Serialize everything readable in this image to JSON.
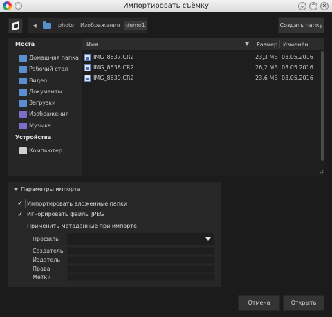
{
  "window": {
    "title": "Импортировать съёмку",
    "controls": {
      "minimize": "⌄",
      "maximize": "⌃",
      "close": "✕"
    }
  },
  "toolbar": {
    "back_icon": "back-icon",
    "breadcrumb": [
      "photo",
      "Изображения",
      "demo1"
    ],
    "create_folder_label": "Создать папку"
  },
  "places": {
    "heading": "Места",
    "items": [
      {
        "label": "Домашняя папка",
        "icon": "home-folder-icon",
        "color": "#5a8fd0"
      },
      {
        "label": "Рабочий стол",
        "icon": "desktop-folder-icon",
        "color": "#5a8fd0"
      },
      {
        "label": "Видео",
        "icon": "video-folder-icon",
        "color": "#5a8fd0"
      },
      {
        "label": "Документы",
        "icon": "documents-folder-icon",
        "color": "#5a8fd0"
      },
      {
        "label": "Загрузки",
        "icon": "downloads-folder-icon",
        "color": "#5a8fd0"
      },
      {
        "label": "Изображения",
        "icon": "pictures-folder-icon",
        "color": "#7a6fc8"
      },
      {
        "label": "Музыка",
        "icon": "music-folder-icon",
        "color": "#7a6fc8"
      }
    ],
    "devices_heading": "Устройства",
    "devices": [
      {
        "label": "Компьютер",
        "icon": "computer-icon",
        "color": "#d0d0d0"
      }
    ]
  },
  "files": {
    "columns": {
      "name": "Имя",
      "size": "Размер",
      "modified": "Изменён"
    },
    "rows": [
      {
        "name": "IMG_8637.CR2",
        "size": "23,3 МБ",
        "modified": "03.05.2016"
      },
      {
        "name": "IMG_8638.CR2",
        "size": "26,2 МБ",
        "modified": "03.05.2016"
      },
      {
        "name": "IMG_8639.CR2",
        "size": "23,6 МБ",
        "modified": "03.05.2016"
      }
    ]
  },
  "import_options": {
    "heading": "Параметры импорта",
    "import_subfolders": {
      "label": "Импортировать вложенные папки",
      "checked": true
    },
    "ignore_jpeg": {
      "label": "Игнорировать файлы JPEG",
      "checked": true
    },
    "apply_metadata": {
      "label": "Применить метаданные при импорте"
    },
    "profile_label": "Профиль",
    "profile_value": "",
    "fields": [
      {
        "label": "Создатель",
        "value": ""
      },
      {
        "label": "Издатель",
        "value": ""
      },
      {
        "label": "Права",
        "value": ""
      },
      {
        "label": "Метки",
        "value": ""
      }
    ]
  },
  "footer": {
    "cancel_label": "Отмена",
    "open_label": "Открыть"
  }
}
